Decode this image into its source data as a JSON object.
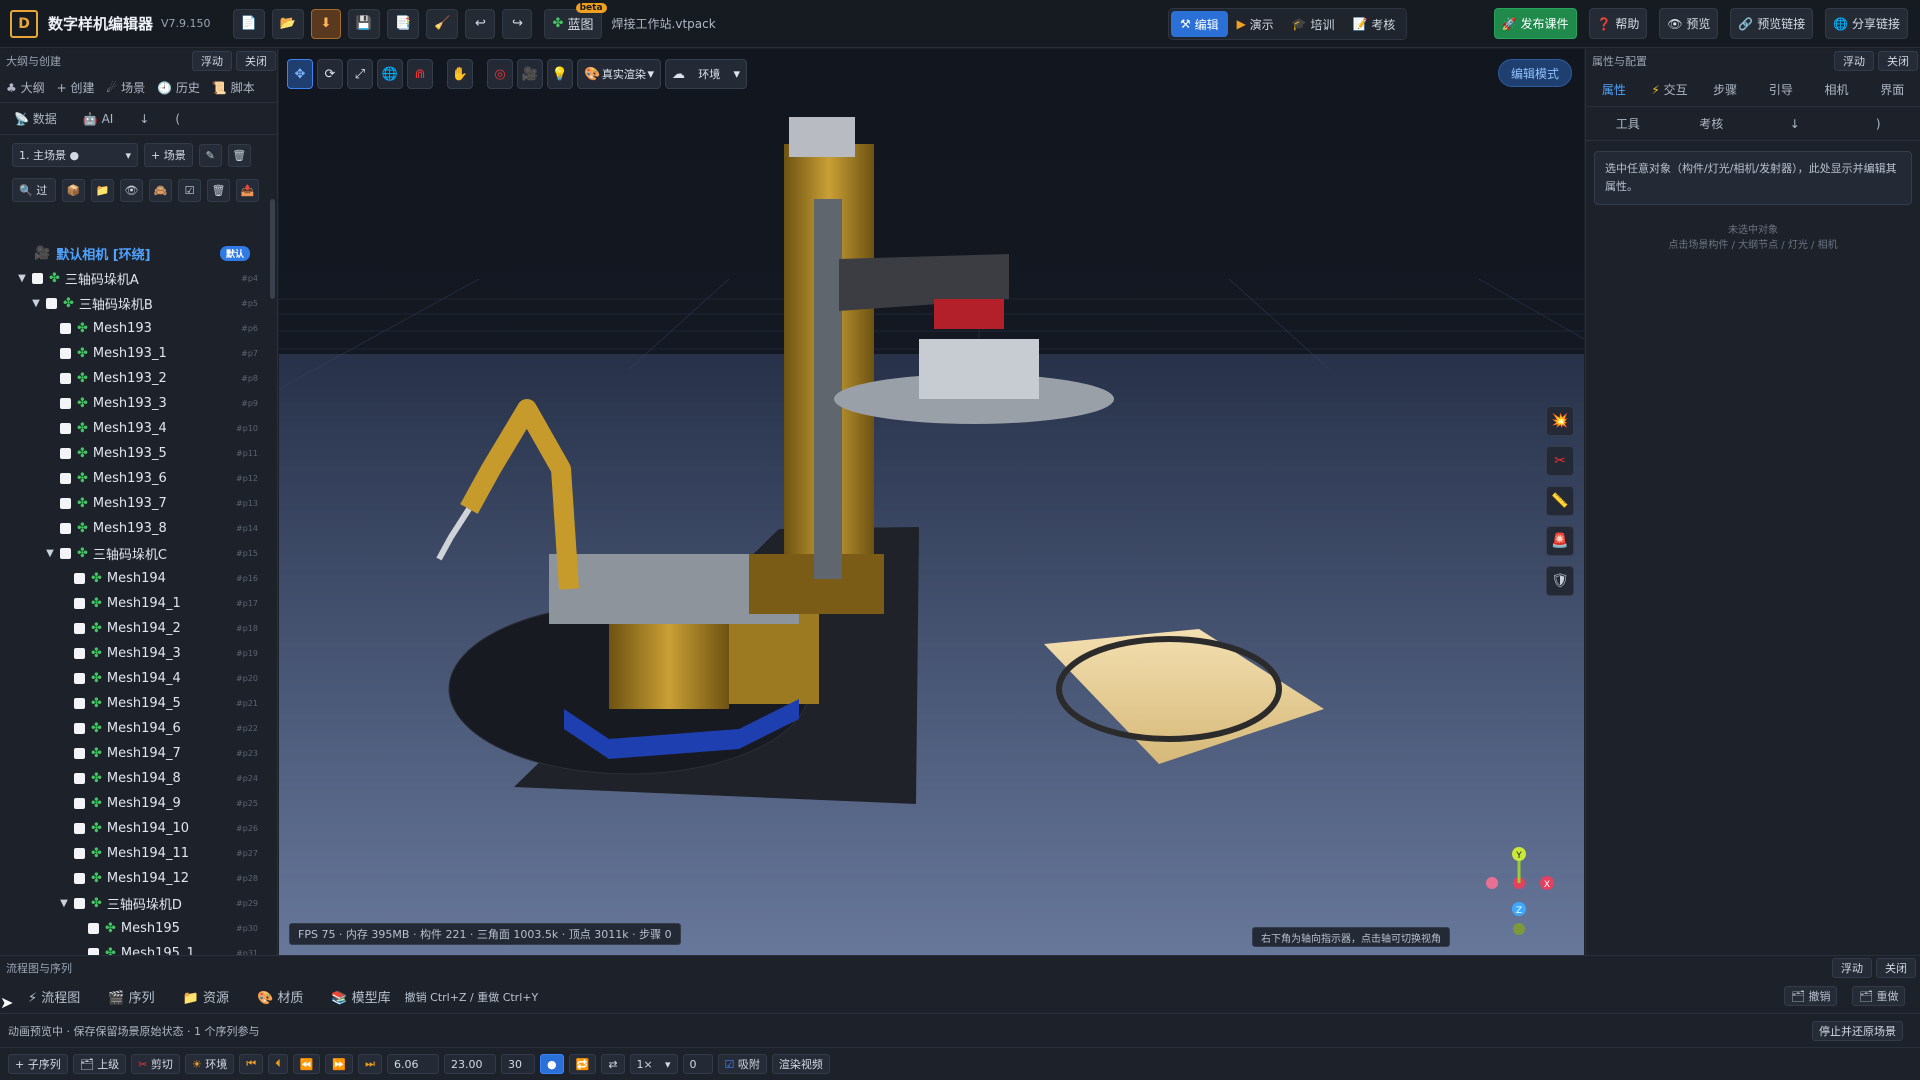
{
  "topbar": {
    "title": "数字样机编辑器",
    "version": "V7.9.150",
    "blueprint_label": "蓝图",
    "beta_badge": "beta",
    "filename": "焊接工作站.vtpack",
    "modes": [
      {
        "label": "编辑",
        "icon": "⚒"
      },
      {
        "label": "演示",
        "icon": "▶"
      },
      {
        "label": "培训",
        "icon": "🎓"
      },
      {
        "label": "考核",
        "icon": "📝"
      }
    ],
    "actions": [
      {
        "label": "发布课件",
        "icon": "🚀"
      },
      {
        "label": "帮助",
        "icon": "❓"
      },
      {
        "label": "预览",
        "icon": "👁"
      },
      {
        "label": "预览链接",
        "icon": "🔗"
      },
      {
        "label": "分享链接",
        "icon": "🌐"
      }
    ]
  },
  "left": {
    "header": "大纲与创建",
    "float": "浮动",
    "close": "关闭",
    "tabs": [
      {
        "label": "大纲",
        "icon": "♣"
      },
      {
        "label": "创建",
        "icon": "+"
      },
      {
        "label": "场景",
        "icon": "☄"
      },
      {
        "label": "历史",
        "icon": "🕘"
      },
      {
        "label": "脚本",
        "icon": "📜"
      }
    ],
    "subtabs": [
      "数据",
      "AI",
      "↓",
      "("
    ],
    "scene_select": "1. 主场景 ●",
    "add_scene": "+ 场景",
    "filter_placeholder": "🔍 过",
    "camera": {
      "label": "默认相机 [环绕]",
      "badge": "默认"
    },
    "tree": [
      {
        "label": "三轴码垛机A",
        "depth": 0,
        "exp": "▼",
        "id": "#p4"
      },
      {
        "label": "三轴码垛机B",
        "depth": 1,
        "exp": "▼",
        "id": "#p5"
      },
      {
        "label": "Mesh193",
        "depth": 2,
        "exp": "",
        "id": "#p6"
      },
      {
        "label": "Mesh193_1",
        "depth": 2,
        "exp": "",
        "id": "#p7"
      },
      {
        "label": "Mesh193_2",
        "depth": 2,
        "exp": "",
        "id": "#p8"
      },
      {
        "label": "Mesh193_3",
        "depth": 2,
        "exp": "",
        "id": "#p9"
      },
      {
        "label": "Mesh193_4",
        "depth": 2,
        "exp": "",
        "id": "#p10"
      },
      {
        "label": "Mesh193_5",
        "depth": 2,
        "exp": "",
        "id": "#p11"
      },
      {
        "label": "Mesh193_6",
        "depth": 2,
        "exp": "",
        "id": "#p12"
      },
      {
        "label": "Mesh193_7",
        "depth": 2,
        "exp": "",
        "id": "#p13"
      },
      {
        "label": "Mesh193_8",
        "depth": 2,
        "exp": "",
        "id": "#p14"
      },
      {
        "label": "三轴码垛机C",
        "depth": 2,
        "exp": "▼",
        "id": "#p15"
      },
      {
        "label": "Mesh194",
        "depth": 3,
        "exp": "",
        "id": "#p16"
      },
      {
        "label": "Mesh194_1",
        "depth": 3,
        "exp": "",
        "id": "#p17"
      },
      {
        "label": "Mesh194_2",
        "depth": 3,
        "exp": "",
        "id": "#p18"
      },
      {
        "label": "Mesh194_3",
        "depth": 3,
        "exp": "",
        "id": "#p19"
      },
      {
        "label": "Mesh194_4",
        "depth": 3,
        "exp": "",
        "id": "#p20"
      },
      {
        "label": "Mesh194_5",
        "depth": 3,
        "exp": "",
        "id": "#p21"
      },
      {
        "label": "Mesh194_6",
        "depth": 3,
        "exp": "",
        "id": "#p22"
      },
      {
        "label": "Mesh194_7",
        "depth": 3,
        "exp": "",
        "id": "#p23"
      },
      {
        "label": "Mesh194_8",
        "depth": 3,
        "exp": "",
        "id": "#p24"
      },
      {
        "label": "Mesh194_9",
        "depth": 3,
        "exp": "",
        "id": "#p25"
      },
      {
        "label": "Mesh194_10",
        "depth": 3,
        "exp": "",
        "id": "#p26"
      },
      {
        "label": "Mesh194_11",
        "depth": 3,
        "exp": "",
        "id": "#p27"
      },
      {
        "label": "Mesh194_12",
        "depth": 3,
        "exp": "",
        "id": "#p28"
      },
      {
        "label": "三轴码垛机D",
        "depth": 3,
        "exp": "▼",
        "id": "#p29"
      },
      {
        "label": "Mesh195",
        "depth": 4,
        "exp": "",
        "id": "#p30"
      },
      {
        "label": "Mesh195_1",
        "depth": 4,
        "exp": "",
        "id": "#p31"
      }
    ]
  },
  "viewport": {
    "render_select": "真实渲染",
    "env_select": "环境",
    "edit_mode": "编辑模式",
    "stats": "FPS 75 · 内存 395MB · 构件 221 · 三角面 1003.5k · 顶点 3011k · 步骤 0",
    "hint": "右下角为轴向指示器，点击轴可切换视角",
    "axis_x": "X",
    "axis_y": "Y",
    "axis_z": "Z"
  },
  "right": {
    "header": "属性与配置",
    "float": "浮动",
    "close": "关闭",
    "tabs": [
      {
        "label": "属性",
        "icon": ""
      },
      {
        "label": "交互",
        "icon": "⚡"
      },
      {
        "label": "步骤",
        "icon": ""
      },
      {
        "label": "引导",
        "icon": ""
      },
      {
        "label": "相机",
        "icon": ""
      },
      {
        "label": "界面",
        "icon": ""
      }
    ],
    "subtabs": [
      "工具",
      "考核",
      "↓",
      ")"
    ],
    "info": "选中任意对象（构件/灯光/相机/发射器），此处显示并编辑其属性。",
    "empty_title": "未选中对象",
    "empty_sub": "点击场景构件 / 大纲节点 / 灯光 / 相机"
  },
  "bottom": {
    "header": "流程图与序列",
    "float": "浮动",
    "close": "关闭",
    "tabs": [
      {
        "label": "流程图",
        "icon": "⚡"
      },
      {
        "label": "序列",
        "icon": "🎬"
      },
      {
        "label": "资源",
        "icon": "📁"
      },
      {
        "label": "材质",
        "icon": "🎨"
      },
      {
        "label": "模型库",
        "icon": "📚"
      }
    ],
    "shortcut": "撤销 Ctrl+Z / 重做 Ctrl+Y",
    "undo": "撤销",
    "redo": "重做",
    "status": "动画预览中 · 保存保留场景原始状态 · 1 个序列参与",
    "stop": "停止并还原场景",
    "controls": {
      "child": "+ 子序列",
      "up": "上级",
      "cut": "剪切",
      "loop": "环境",
      "t1": "6.06",
      "t2": "23.00",
      "fps": "30",
      "speed": "1×",
      "frame": "0",
      "snap": "吸附",
      "render": "渲染视频"
    }
  }
}
